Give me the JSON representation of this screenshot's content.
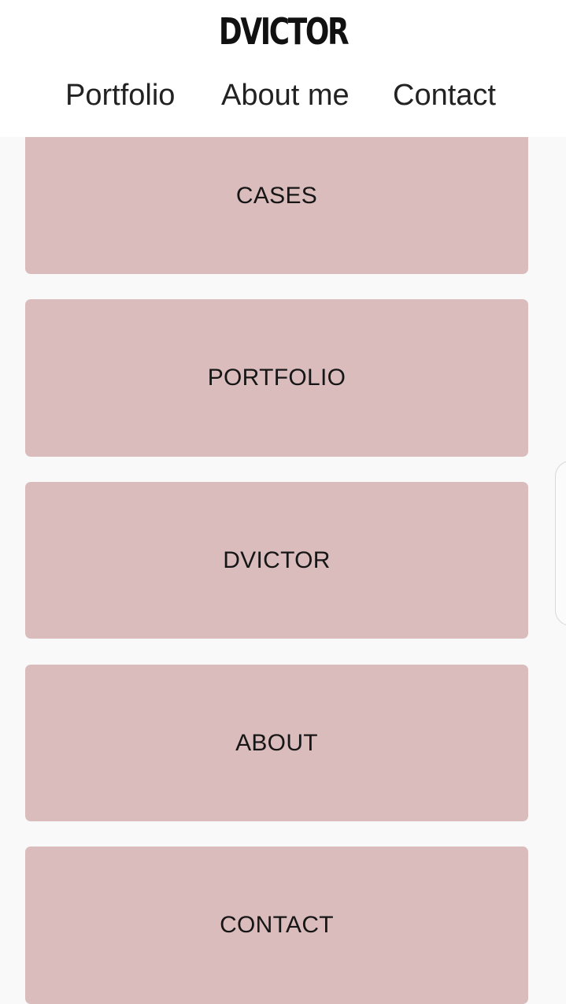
{
  "header": {
    "logo": "DVICTOR",
    "nav": [
      {
        "label": "Portfolio"
      },
      {
        "label": "About me"
      },
      {
        "label": "Contact"
      }
    ]
  },
  "cards": [
    {
      "label": "CASES"
    },
    {
      "label": "PORTFOLIO"
    },
    {
      "label": "DVICTOR"
    },
    {
      "label": "ABOUT"
    },
    {
      "label": "CONTACT"
    }
  ],
  "colors": {
    "card_background": "#dbbcbc",
    "page_background": "#f9f9f9",
    "header_background": "#ffffff"
  }
}
